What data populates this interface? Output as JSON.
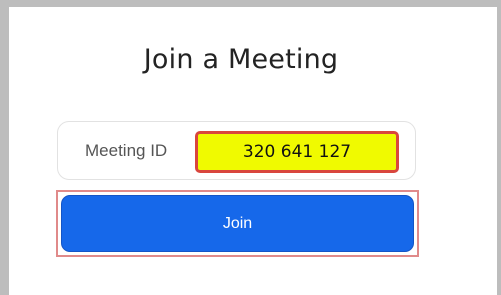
{
  "dialog": {
    "title": "Join a Meeting"
  },
  "meeting_id_field": {
    "label": "Meeting ID",
    "value": "320 641 127",
    "highlight_color": "#f0fa00",
    "annotation_color": "#d9463d"
  },
  "join_button": {
    "label": "Join",
    "color": "#1668ea"
  }
}
